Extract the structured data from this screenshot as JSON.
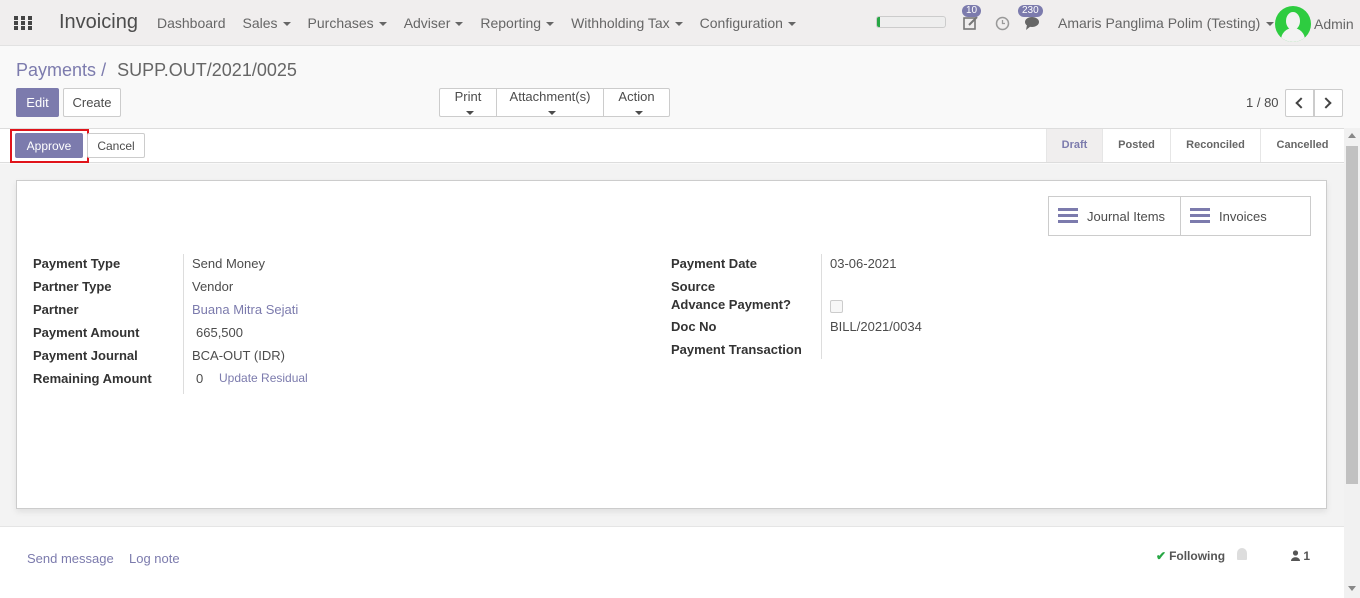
{
  "navbar": {
    "app_title": "Invoicing",
    "menu": [
      {
        "label": "Dashboard",
        "dropdown": false
      },
      {
        "label": "Sales",
        "dropdown": true
      },
      {
        "label": "Purchases",
        "dropdown": true
      },
      {
        "label": "Adviser",
        "dropdown": true
      },
      {
        "label": "Reporting",
        "dropdown": true
      },
      {
        "label": "Withholding Tax",
        "dropdown": true
      },
      {
        "label": "Configuration",
        "dropdown": true
      }
    ],
    "progress_fraction": 0.05,
    "activity_count": "10",
    "messages_count": "230",
    "company_user": "Amaris Panglima Polim (Testing)",
    "user_name": "Admin",
    "icons": [
      "apps-icon",
      "edit-activity-icon",
      "clock-icon",
      "chat-icon",
      "avatar"
    ]
  },
  "breadcrumb": {
    "parent": "Payments",
    "separator": "/",
    "current": "SUPP.OUT/2021/0025"
  },
  "toolbar": {
    "edit_label": "Edit",
    "create_label": "Create",
    "print_label": "Print",
    "attachments_label": "Attachment(s)",
    "action_label": "Action"
  },
  "pager": {
    "value": "1 / 80"
  },
  "statusbar": {
    "approve_label": "Approve",
    "cancel_label": "Cancel",
    "stages": [
      "Draft",
      "Posted",
      "Reconciled",
      "Cancelled"
    ],
    "active_stage": "Draft"
  },
  "smart_buttons": {
    "journal_items_label": "Journal Items",
    "invoices_label": "Invoices"
  },
  "form": {
    "left": [
      {
        "label": "Payment Type",
        "value": "Send Money"
      },
      {
        "label": "Partner Type",
        "value": "Vendor"
      },
      {
        "label": "Partner",
        "value": "Buana Mitra Sejati"
      },
      {
        "label": "Payment Amount",
        "value": "665,500"
      },
      {
        "label": "Payment Journal",
        "value": "BCA-OUT (IDR)"
      },
      {
        "label": "Remaining Amount",
        "value": "0"
      }
    ],
    "update_residual_label": "Update Residual",
    "right": [
      {
        "label": "Payment Date",
        "value": "03-06-2021"
      },
      {
        "label": "Source",
        "value": ""
      },
      {
        "label": "Advance Payment?",
        "value": ""
      },
      {
        "label": "Doc No",
        "value": "BILL/2021/0034"
      },
      {
        "label": "Payment Transaction",
        "value": ""
      }
    ],
    "advance_payment_checked": false
  },
  "chatter": {
    "send_message_label": "Send message",
    "log_note_label": "Log note",
    "following_label": "Following",
    "followers_count": "1"
  },
  "colors": {
    "primary": "#7c7bad",
    "highlight": "#e0141b",
    "progress": "#28a745",
    "avatar": "#2ecc40"
  }
}
